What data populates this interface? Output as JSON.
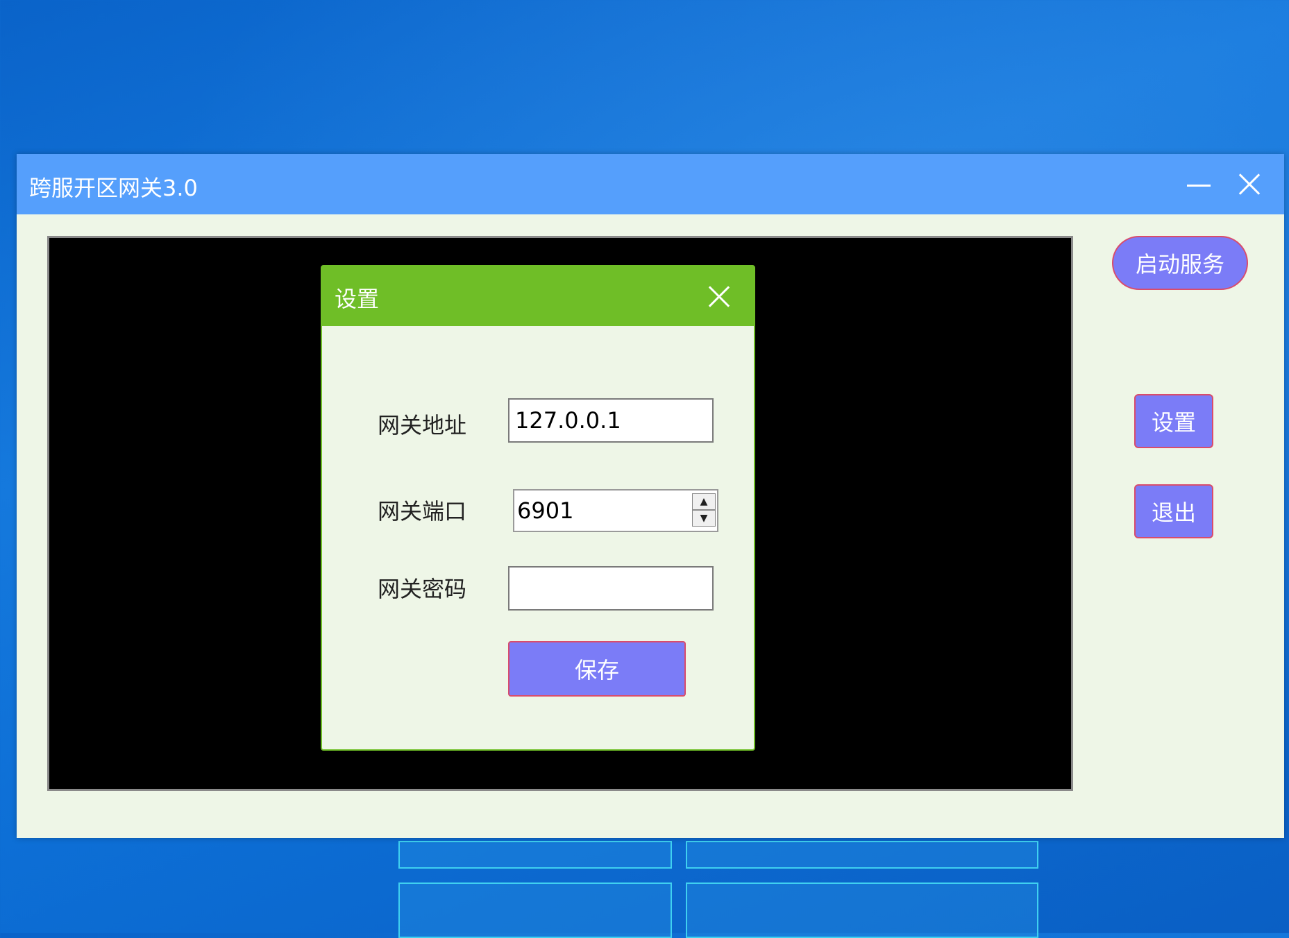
{
  "window": {
    "title": "跨服开区网关3.0"
  },
  "sidebar": {
    "start_label": "启动服务",
    "settings_label": "设置",
    "exit_label": "退出"
  },
  "dialog": {
    "title": "设置",
    "address_label": "网关地址",
    "address_value": "127.0.0.1",
    "port_label": "网关端口",
    "port_value": "6901",
    "password_label": "网关密码",
    "password_value": "",
    "save_label": "保存"
  },
  "icons": {
    "minimize": "minimize-icon",
    "close": "close-icon",
    "spin_up": "chevron-up-icon",
    "spin_down": "chevron-down-icon"
  },
  "colors": {
    "title_bar": "#559ffc",
    "dialog_bar": "#6fbe27",
    "button_fill": "#7b7cf7",
    "button_border": "#d94c6c",
    "window_bg": "#eef6e7"
  }
}
